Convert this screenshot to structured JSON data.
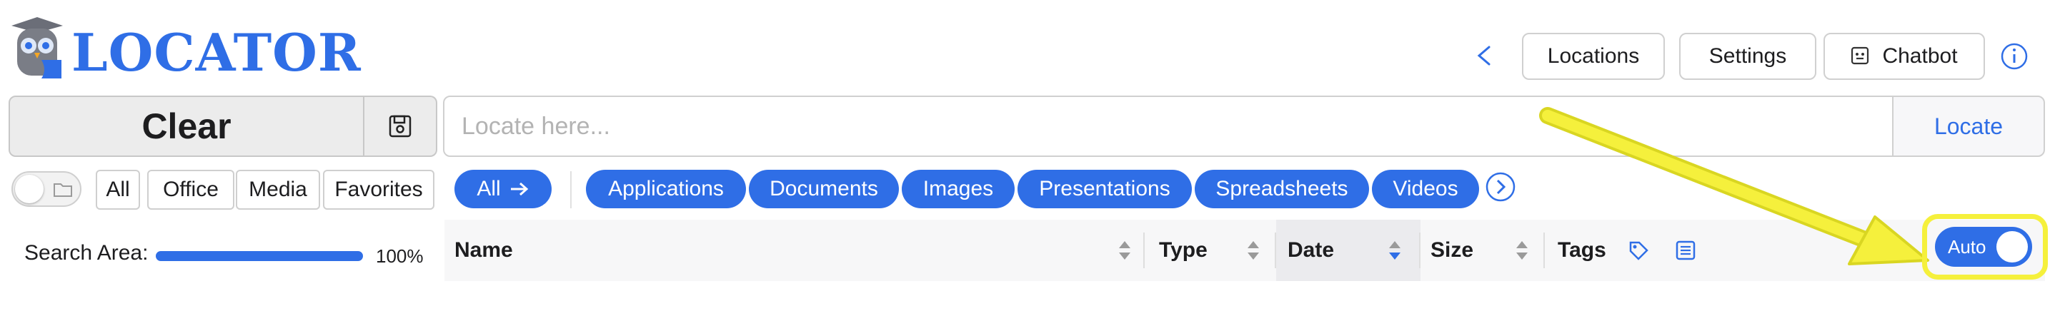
{
  "header": {
    "app_name": "LOCATOR",
    "buttons": {
      "locations": "Locations",
      "settings": "Settings",
      "chatbot": "Chatbot"
    }
  },
  "search": {
    "clear_label": "Clear",
    "placeholder": "Locate here...",
    "locate_label": "Locate"
  },
  "filters": {
    "scope": [
      "All",
      "Office",
      "Media",
      "Favorites"
    ],
    "categories": [
      "All",
      "Applications",
      "Documents",
      "Images",
      "Presentations",
      "Spreadsheets",
      "Videos"
    ]
  },
  "search_area": {
    "label": "Search Area:",
    "value_text": "100%",
    "value": 100
  },
  "table": {
    "columns": [
      "Name",
      "Type",
      "Date",
      "Size",
      "Tags"
    ],
    "sorted_column": "Date",
    "sort_direction": "descending"
  },
  "auto_toggle": {
    "label": "Auto",
    "on": true
  },
  "colors": {
    "accent": "#2f6ee6",
    "highlight": "#f5f03c"
  },
  "icons": [
    "owl-logo-icon",
    "chevron-left-icon",
    "chatbot-icon",
    "info-icon",
    "save-icon",
    "folder-icon",
    "arrow-right-icon",
    "chevron-right-circle-icon",
    "sort-icon",
    "tag-icon",
    "list-icon"
  ]
}
